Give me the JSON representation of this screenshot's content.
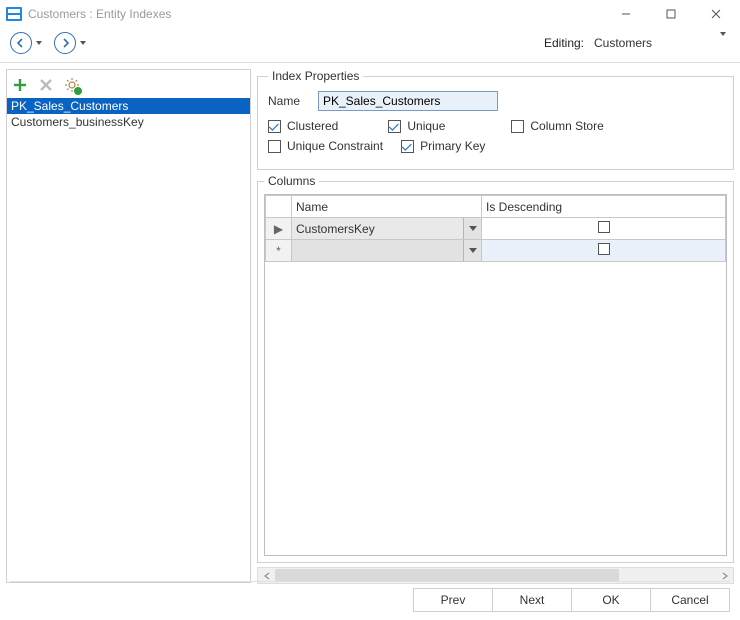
{
  "window": {
    "title": "Customers : Entity Indexes"
  },
  "editing": {
    "label": "Editing:",
    "value": "Customers"
  },
  "indexes": {
    "items": [
      {
        "name": "PK_Sales_Customers",
        "selected": true
      },
      {
        "name": "Customers_businessKey",
        "selected": false
      }
    ]
  },
  "indexProps": {
    "legend": "Index Properties",
    "nameLabel": "Name",
    "nameValue": "PK_Sales_Customers",
    "clustered": {
      "label": "Clustered",
      "checked": true
    },
    "unique": {
      "label": "Unique",
      "checked": true
    },
    "columnStore": {
      "label": "Column Store",
      "checked": false
    },
    "uniqueConstraint": {
      "label": "Unique Constraint",
      "checked": false
    },
    "primaryKey": {
      "label": "Primary Key",
      "checked": true
    }
  },
  "columns": {
    "legend": "Columns",
    "headers": {
      "name": "Name",
      "desc": "Is Descending"
    },
    "rows": [
      {
        "marker": "▶",
        "name": "CustomersKey",
        "desc": false
      },
      {
        "marker": "*",
        "name": "",
        "desc": false,
        "new": true
      }
    ]
  },
  "buttons": {
    "prev": "Prev",
    "next": "Next",
    "ok": "OK",
    "cancel": "Cancel"
  }
}
